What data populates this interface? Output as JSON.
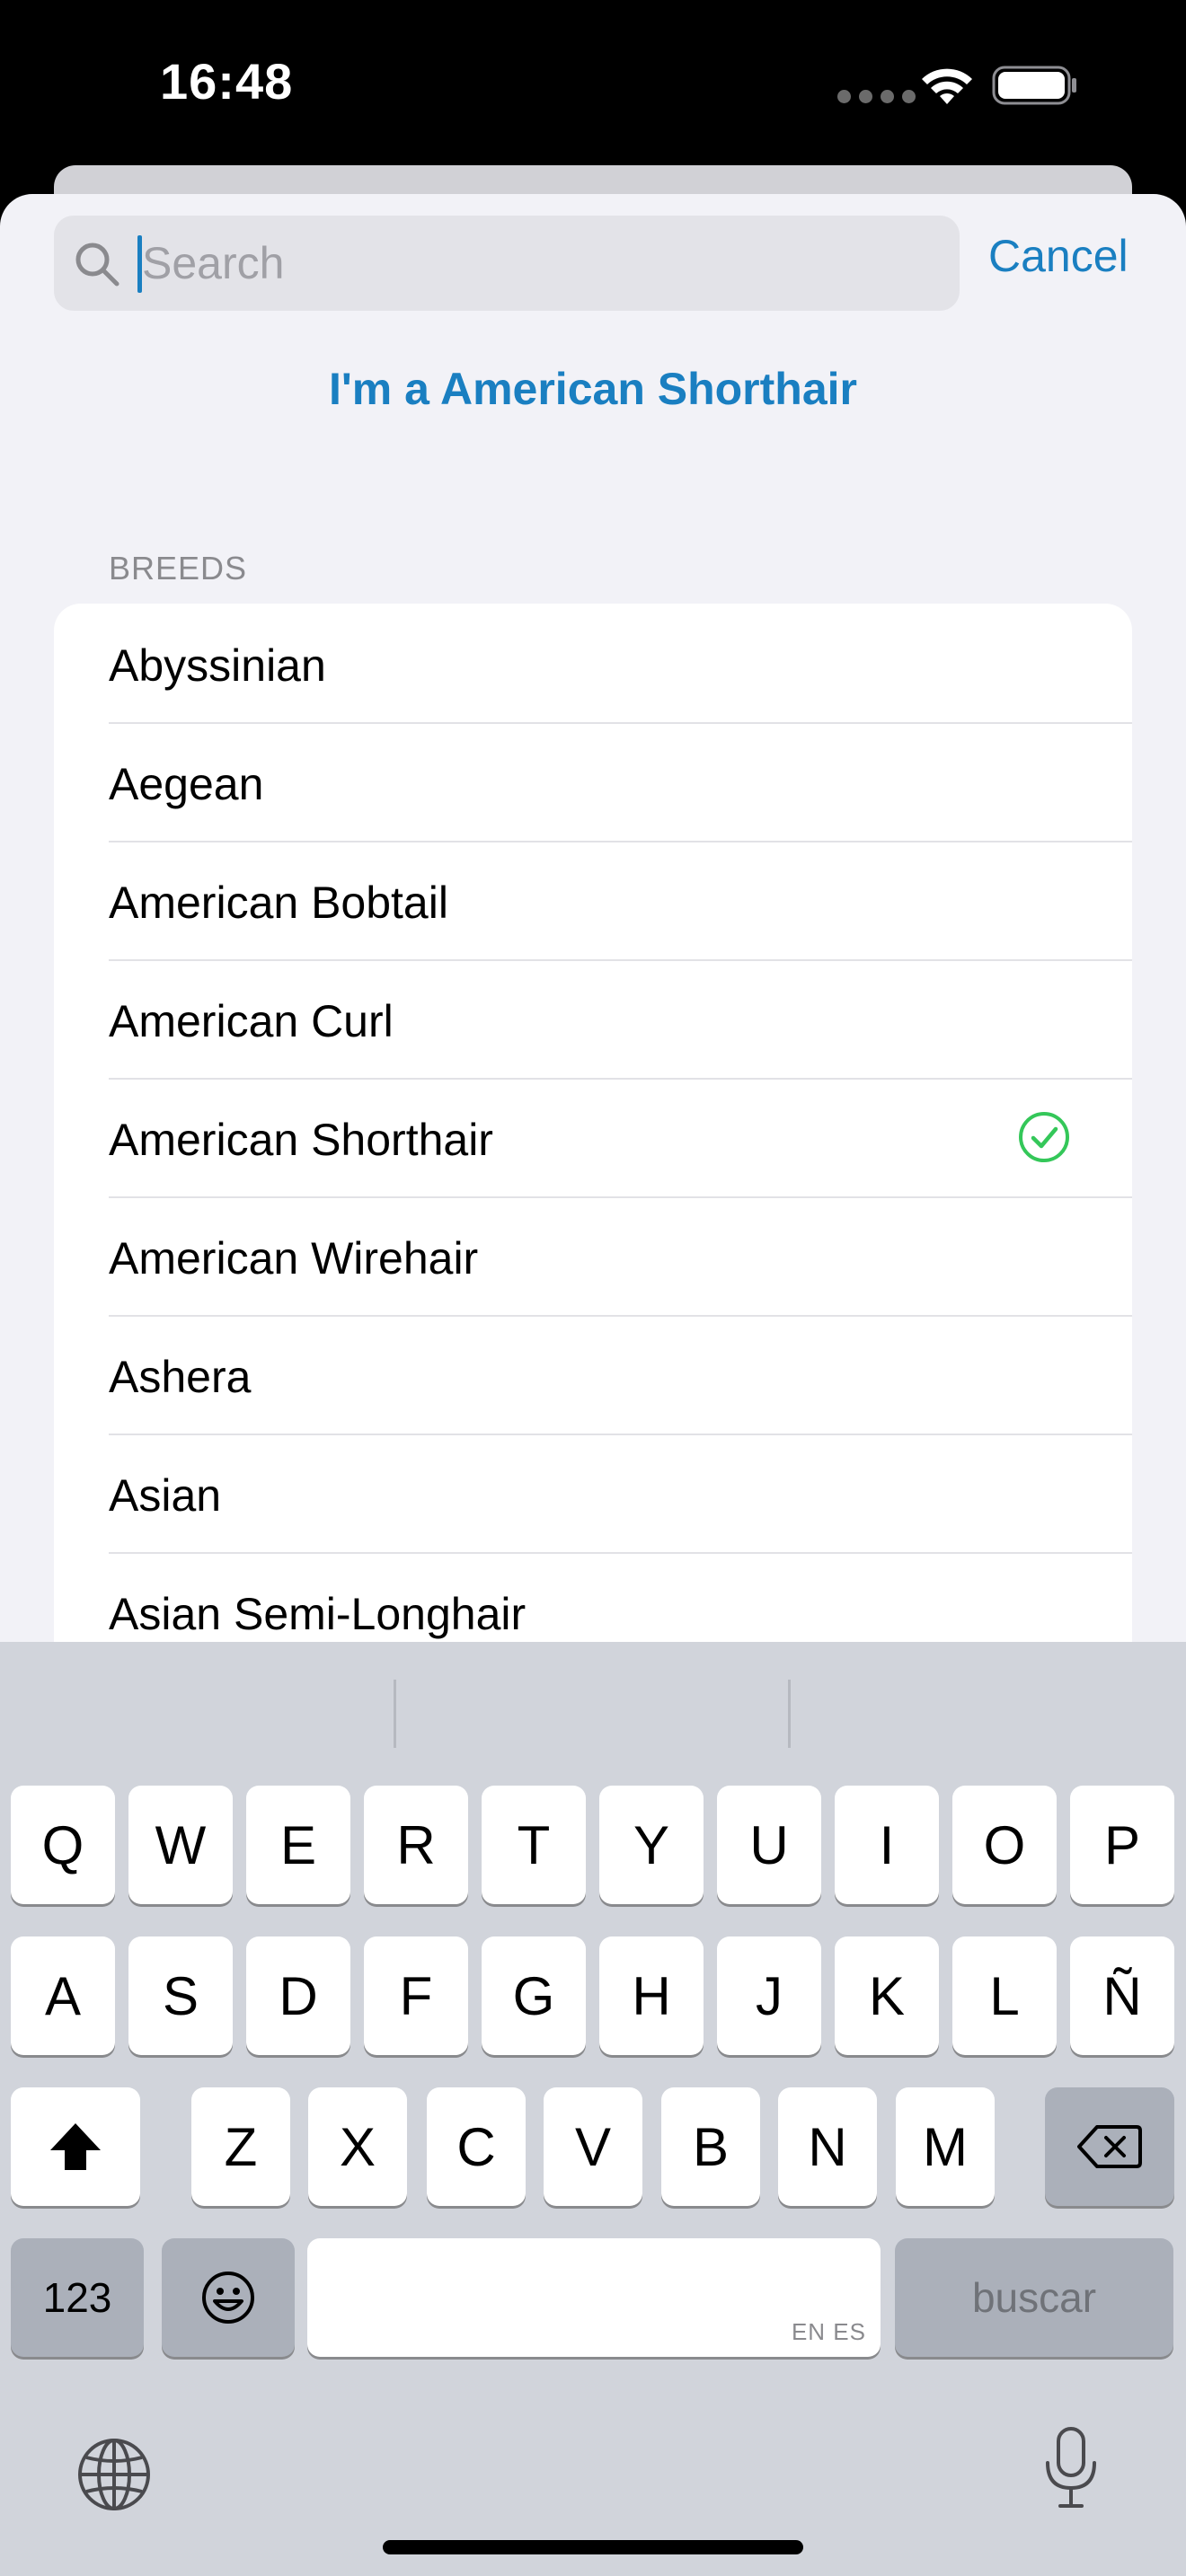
{
  "status_bar": {
    "time": "16:48"
  },
  "search": {
    "placeholder": "Search",
    "value": "",
    "cancel_label": "Cancel"
  },
  "selection_title": "I'm a American Shorthair",
  "section_header": "BREEDS",
  "breeds": [
    {
      "label": "Abyssinian",
      "selected": false
    },
    {
      "label": "Aegean",
      "selected": false
    },
    {
      "label": "American Bobtail",
      "selected": false
    },
    {
      "label": "American Curl",
      "selected": false
    },
    {
      "label": "American Shorthair",
      "selected": true
    },
    {
      "label": "American Wirehair",
      "selected": false
    },
    {
      "label": "Ashera",
      "selected": false
    },
    {
      "label": "Asian",
      "selected": false
    },
    {
      "label": "Asian Semi-Longhair",
      "selected": false
    }
  ],
  "keyboard": {
    "row1": [
      "Q",
      "W",
      "E",
      "R",
      "T",
      "Y",
      "U",
      "I",
      "O",
      "P"
    ],
    "row2": [
      "A",
      "S",
      "D",
      "F",
      "G",
      "H",
      "J",
      "K",
      "L",
      "Ñ"
    ],
    "row3": [
      "Z",
      "X",
      "C",
      "V",
      "B",
      "N",
      "M"
    ],
    "numbers_label": "123",
    "space_lang": "EN ES",
    "return_label": "buscar"
  },
  "colors": {
    "accent": "#1a7fc1",
    "check": "#34c759",
    "sheet_bg": "#f2f2f7",
    "keyboard_bg": "#d1d4db"
  }
}
